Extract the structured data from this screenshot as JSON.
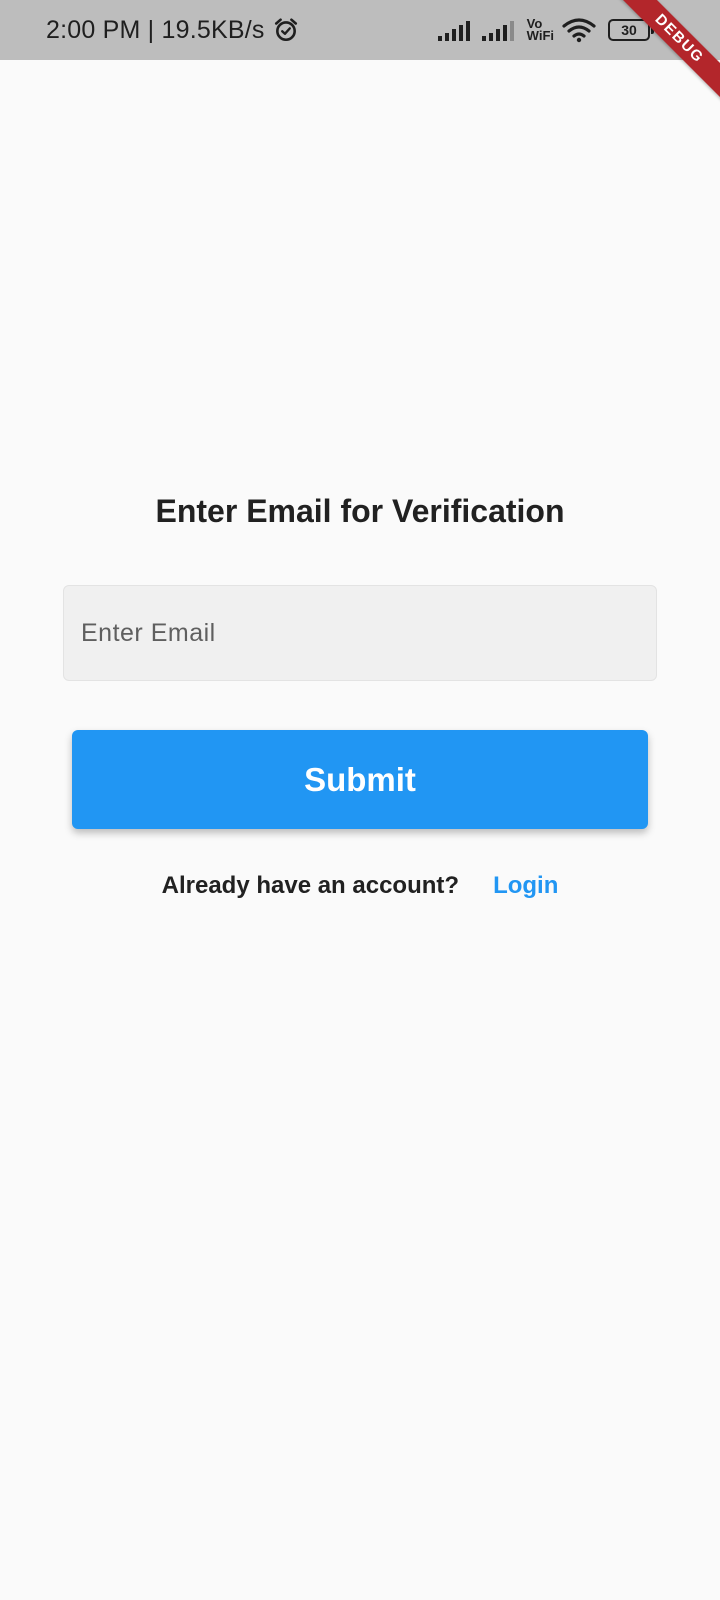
{
  "status_bar": {
    "time_speed": "2:00 PM | 19.5KB/s",
    "alarm_icon": "alarm-icon",
    "signal_icon": "signal-bars-icon",
    "vowifi_top": "Vo",
    "vowifi_bottom": "WiFi",
    "wifi_icon": "wifi-icon",
    "battery_level": "30"
  },
  "debug_banner": {
    "label": "DEBUG",
    "color": "#b3262b"
  },
  "screen": {
    "title": "Enter Email for Verification",
    "email_field": {
      "value": "",
      "placeholder": "Enter Email"
    },
    "submit_label": "Submit",
    "login_prompt": "Already have an account?",
    "login_link": "Login"
  },
  "colors": {
    "accent": "#2196f3",
    "background": "#fafafa",
    "status_bar": "#bdbdbd"
  }
}
